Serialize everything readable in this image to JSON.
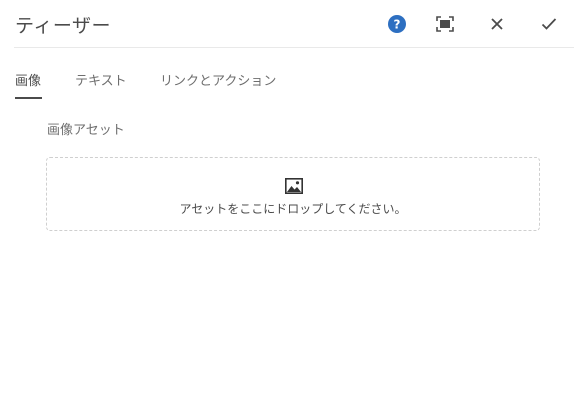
{
  "dialog": {
    "title": "ティーザー",
    "actions": {
      "help_icon": "help-circle-icon",
      "fullscreen_icon": "fullscreen-icon",
      "close_icon": "close-icon",
      "done_icon": "checkmark-icon"
    }
  },
  "tabs": [
    {
      "label": "画像",
      "selected": true
    },
    {
      "label": "テキスト",
      "selected": false
    },
    {
      "label": "リンクとアクション",
      "selected": false
    }
  ],
  "image_tab": {
    "field_label": "画像アセット",
    "dropzone": {
      "icon": "image-icon",
      "text": "アセットをここにドロップしてください。"
    }
  },
  "colors": {
    "help_blue": "#2d6fc1",
    "text": "#4b4b4b",
    "border": "#cfcfcf"
  }
}
